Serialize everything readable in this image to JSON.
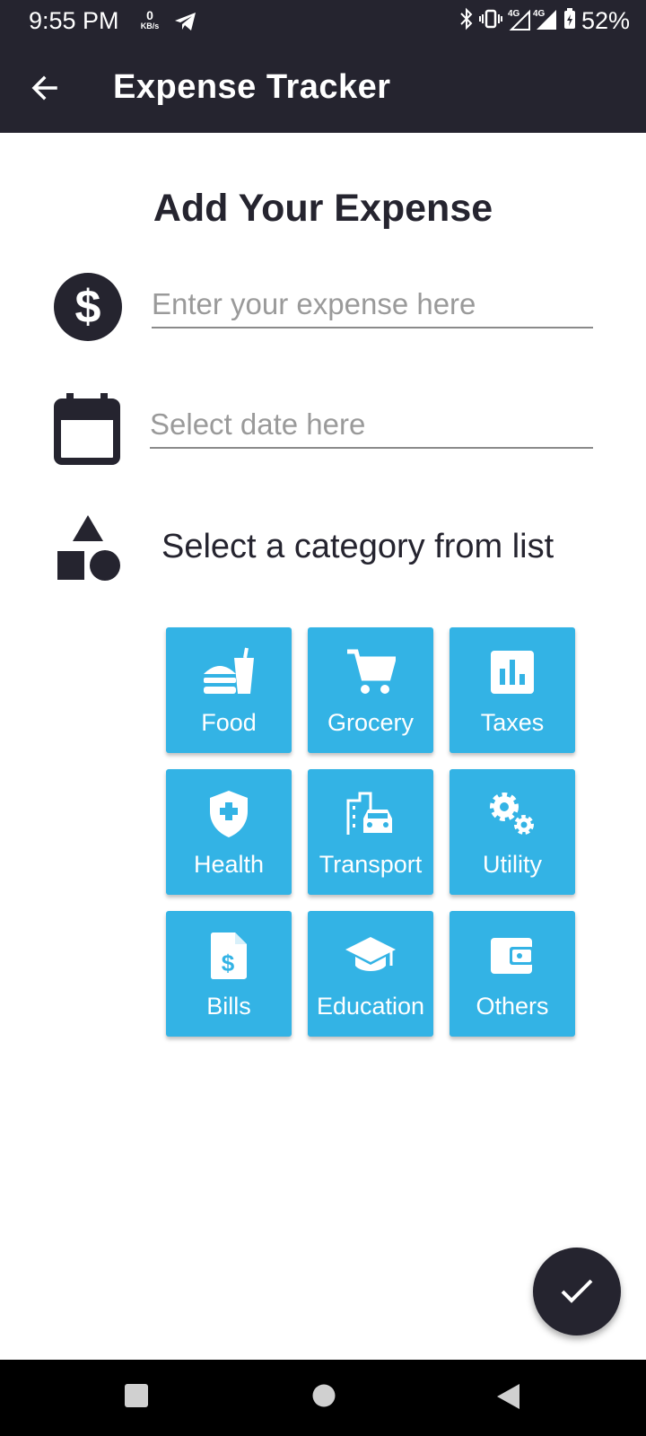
{
  "status_bar": {
    "time": "9:55 PM",
    "net_speed_value": "0",
    "net_speed_unit": "KB/s",
    "battery": "52%"
  },
  "app_bar": {
    "title": "Expense Tracker",
    "back_icon": "arrow-back-icon"
  },
  "form": {
    "heading": "Add Your Expense",
    "expense_placeholder": "Enter your expense here",
    "date_placeholder": "Select date here",
    "category_prompt": "Select a category from list"
  },
  "categories": [
    {
      "label": "Food",
      "icon": "fastfood-icon"
    },
    {
      "label": "Grocery",
      "icon": "shopping-cart-icon"
    },
    {
      "label": "Taxes",
      "icon": "bar-chart-icon"
    },
    {
      "label": "Health",
      "icon": "health-shield-icon"
    },
    {
      "label": "Transport",
      "icon": "transport-icon"
    },
    {
      "label": "Utility",
      "icon": "gears-icon"
    },
    {
      "label": "Bills",
      "icon": "bill-document-icon"
    },
    {
      "label": "Education",
      "icon": "graduation-cap-icon"
    },
    {
      "label": "Others",
      "icon": "wallet-icon"
    }
  ],
  "colors": {
    "dark": "#25242f",
    "tile": "#33b3e5"
  }
}
